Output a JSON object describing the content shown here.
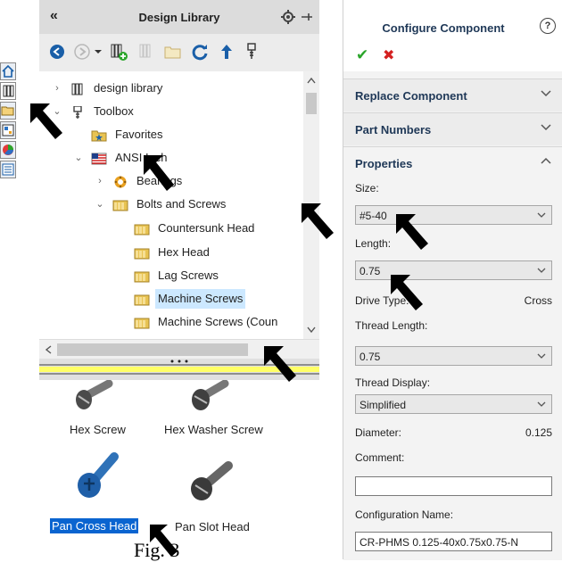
{
  "library": {
    "title": "Design Library",
    "collapse_glyph": "«",
    "tree": [
      {
        "label": "design library",
        "twisty": "›",
        "icon": "library-icon"
      },
      {
        "label": "Toolbox",
        "twisty": "⌄",
        "icon": "toolbox-icon"
      },
      {
        "label": "Favorites",
        "twisty": "",
        "icon": "favorites-folder-icon"
      },
      {
        "label": "ANSI Inch",
        "twisty": "⌄",
        "icon": "us-flag-icon"
      },
      {
        "label": "Bearings",
        "twisty": "›",
        "icon": "bearing-icon"
      },
      {
        "label": "Bolts and Screws",
        "twisty": "⌄",
        "icon": "folder-icon"
      },
      {
        "label": "Countersunk Head",
        "twisty": "",
        "icon": "folder-icon"
      },
      {
        "label": "Hex Head",
        "twisty": "",
        "icon": "folder-icon"
      },
      {
        "label": "Lag Screws",
        "twisty": "",
        "icon": "folder-icon"
      },
      {
        "label": "Machine Screws",
        "twisty": "",
        "icon": "folder-icon"
      },
      {
        "label": "Machine Screws (Coun",
        "twisty": "",
        "icon": "folder-icon"
      }
    ],
    "thumbnails": [
      {
        "label": "Hex Screw"
      },
      {
        "label": "Hex Washer Screw"
      },
      {
        "label": "Pan Cross Head"
      },
      {
        "label": "Pan Slot Head"
      }
    ]
  },
  "configure": {
    "title": "Configure Component",
    "help_glyph": "?",
    "ok_glyph": "✔",
    "cancel_glyph": "✖",
    "sections": {
      "replace": "Replace Component",
      "part_numbers": "Part Numbers",
      "properties": "Properties"
    },
    "size_label": "Size:",
    "size_value": "#5-40",
    "length_label": "Length:",
    "length_value": "0.75",
    "drive_label": "Drive Type:",
    "drive_value": "Cross",
    "thread_length_label": "Thread Length:",
    "thread_length_value": "0.75",
    "thread_display_label": "Thread Display:",
    "thread_display_value": "Simplified",
    "diameter_label": "Diameter:",
    "diameter_value": "0.125",
    "comment_label": "Comment:",
    "comment_value": "",
    "config_name_label": "Configuration Name:",
    "config_name_value": "CR-PHMS 0.125-40x0.75x0.75-N"
  },
  "caption": "Fig. 3",
  "colors": {
    "accent_green": "#2aa52a",
    "cancel_red": "#d42020",
    "selection": "#cce8ff",
    "header_blue": "#1f3857",
    "folder_yellow": "#e8c352"
  }
}
